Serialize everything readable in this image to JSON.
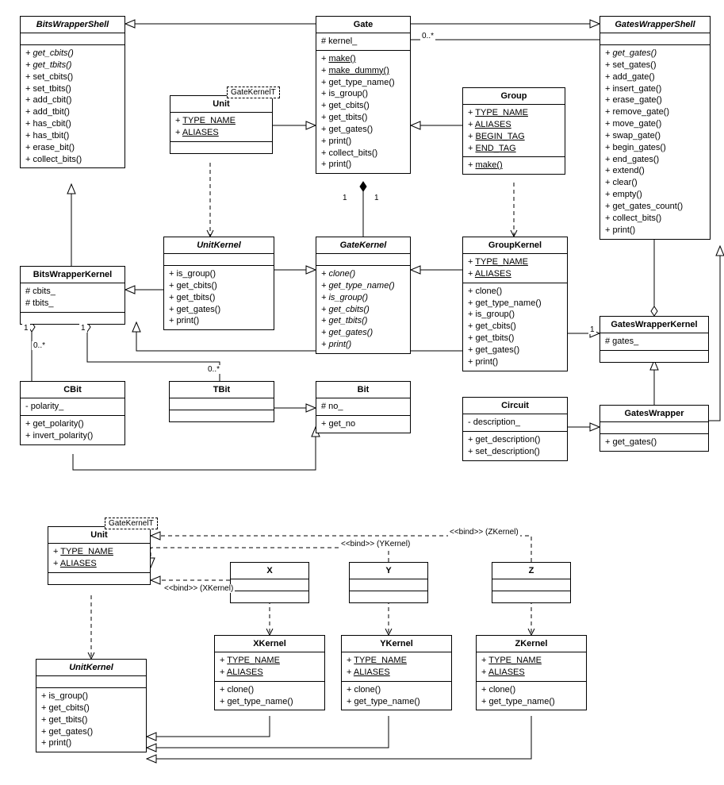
{
  "classes": {
    "BitsWrapperShell": {
      "name": "BitsWrapperShell",
      "italic": true,
      "sections": [
        {
          "items": [],
          "empty": true
        },
        {
          "items": [
            {
              "t": "+ get_cbits()",
              "i": true
            },
            {
              "t": "+ get_tbits()",
              "i": true
            },
            {
              "t": "+ set_cbits()"
            },
            {
              "t": "+ set_tbits()"
            },
            {
              "t": "+ add_cbit()"
            },
            {
              "t": "+ add_tbit()"
            },
            {
              "t": "+ has_cbit()"
            },
            {
              "t": "+ has_tbit()"
            },
            {
              "t": "+ erase_bit()"
            },
            {
              "t": "+ collect_bits()"
            }
          ]
        }
      ]
    },
    "Gate": {
      "name": "Gate",
      "sections": [
        {
          "items": [
            {
              "t": "# kernel_"
            }
          ]
        },
        {
          "items": [
            {
              "t": "+ ",
              "u": "make()"
            },
            {
              "t": "+ ",
              "u": "make_dummy()"
            },
            {
              "t": "+ get_type_name()"
            },
            {
              "t": "+ is_group()"
            },
            {
              "t": "+ get_cbits()"
            },
            {
              "t": "+ get_tbits()"
            },
            {
              "t": "+ get_gates()"
            },
            {
              "t": "+ print()"
            },
            {
              "t": "+ collect_bits()"
            },
            {
              "t": "+ print()"
            }
          ]
        }
      ]
    },
    "GatesWrapperShell": {
      "name": "GatesWrapperShell",
      "italic": true,
      "sections": [
        {
          "items": [],
          "empty": true
        },
        {
          "items": [
            {
              "t": "+ get_gates()",
              "i": true
            },
            {
              "t": "+ set_gates()"
            },
            {
              "t": "+ add_gate()"
            },
            {
              "t": "+ insert_gate()"
            },
            {
              "t": "+ erase_gate()"
            },
            {
              "t": "+ remove_gate()"
            },
            {
              "t": "+ move_gate()"
            },
            {
              "t": "+ swap_gate()"
            },
            {
              "t": "+ begin_gates()"
            },
            {
              "t": "+ end_gates()"
            },
            {
              "t": "+ extend()"
            },
            {
              "t": "+ clear()"
            },
            {
              "t": "+ empty()"
            },
            {
              "t": "+ get_gates_count()"
            },
            {
              "t": "+ collect_bits()"
            },
            {
              "t": "+ print()"
            }
          ]
        }
      ]
    },
    "Unit": {
      "name": "Unit",
      "template": "GateKernelT",
      "sections": [
        {
          "items": [
            {
              "t": "+ ",
              "u": "TYPE_NAME"
            },
            {
              "t": "+ ",
              "u": "ALIASES"
            }
          ]
        },
        {
          "items": [],
          "empty": true
        }
      ]
    },
    "Group": {
      "name": "Group",
      "sections": [
        {
          "items": [
            {
              "t": "+ ",
              "u": "TYPE_NAME"
            },
            {
              "t": "+ ",
              "u": "ALIASES"
            },
            {
              "t": "+ ",
              "u": "BEGIN_TAG"
            },
            {
              "t": "+ ",
              "u": "END_TAG"
            }
          ]
        },
        {
          "items": [
            {
              "t": "+ ",
              "u": "make()"
            }
          ]
        }
      ]
    },
    "UnitKernel": {
      "name": "UnitKernel",
      "italic": true,
      "sections": [
        {
          "items": [],
          "empty": true
        },
        {
          "items": [
            {
              "t": "+ is_group()"
            },
            {
              "t": "+ get_cbits()"
            },
            {
              "t": "+ get_tbits()"
            },
            {
              "t": "+ get_gates()"
            },
            {
              "t": "+ print()"
            }
          ]
        }
      ]
    },
    "GateKernel": {
      "name": "GateKernel",
      "italic": true,
      "sections": [
        {
          "items": [],
          "empty": true
        },
        {
          "items": [
            {
              "t": "+ clone()",
              "i": true
            },
            {
              "t": "+ get_type_name()",
              "i": true
            },
            {
              "t": "+ is_group()",
              "i": true
            },
            {
              "t": "+ get_cbits()",
              "i": true
            },
            {
              "t": "+ get_tbits()",
              "i": true
            },
            {
              "t": "+ get_gates()",
              "i": true
            },
            {
              "t": "+ print()",
              "i": true
            }
          ]
        }
      ]
    },
    "GroupKernel": {
      "name": "GroupKernel",
      "sections": [
        {
          "items": [
            {
              "t": "+ ",
              "u": "TYPE_NAME"
            },
            {
              "t": "+ ",
              "u": "ALIASES"
            }
          ]
        },
        {
          "items": [
            {
              "t": "+ clone()"
            },
            {
              "t": "+ get_type_name()"
            },
            {
              "t": "+ is_group()"
            },
            {
              "t": "+ get_cbits()"
            },
            {
              "t": "+ get_tbits()"
            },
            {
              "t": "+ get_gates()"
            },
            {
              "t": "+ print()"
            }
          ]
        }
      ]
    },
    "BitsWrapperKernel": {
      "name": "BitsWrapperKernel",
      "sections": [
        {
          "items": [
            {
              "t": "# cbits_"
            },
            {
              "t": "# tbits_"
            }
          ]
        },
        {
          "items": [],
          "empty": true
        }
      ]
    },
    "GatesWrapperKernel": {
      "name": "GatesWrapperKernel",
      "sections": [
        {
          "items": [
            {
              "t": "# gates_"
            }
          ]
        },
        {
          "items": [],
          "empty": true
        }
      ]
    },
    "CBit": {
      "name": "CBit",
      "sections": [
        {
          "items": [
            {
              "t": "- polarity_"
            }
          ]
        },
        {
          "items": [
            {
              "t": "+ get_polarity()"
            },
            {
              "t": "+ invert_polarity()"
            }
          ]
        }
      ]
    },
    "TBit": {
      "name": "TBit",
      "sections": [
        {
          "items": [],
          "empty": true
        },
        {
          "items": [],
          "empty": true
        }
      ]
    },
    "Bit": {
      "name": "Bit",
      "sections": [
        {
          "items": [
            {
              "t": "# no_"
            }
          ]
        },
        {
          "items": [
            {
              "t": "+ get_no"
            }
          ]
        }
      ]
    },
    "Circuit": {
      "name": "Circuit",
      "sections": [
        {
          "items": [
            {
              "t": "- description_"
            }
          ]
        },
        {
          "items": [
            {
              "t": "+ get_description()"
            },
            {
              "t": "+ set_description()"
            }
          ]
        }
      ]
    },
    "GatesWrapper": {
      "name": "GatesWrapper",
      "sections": [
        {
          "items": [],
          "empty": true
        },
        {
          "items": [
            {
              "t": "+ get_gates()"
            }
          ]
        }
      ]
    },
    "Unit2": {
      "name": "Unit",
      "template": "GateKernelT",
      "sections": [
        {
          "items": [
            {
              "t": "+ ",
              "u": "TYPE_NAME"
            },
            {
              "t": "+ ",
              "u": "ALIASES"
            }
          ]
        },
        {
          "items": [],
          "empty": true
        }
      ]
    },
    "X": {
      "name": "X",
      "sections": [
        {
          "items": [],
          "empty": true
        },
        {
          "items": [],
          "empty": true
        }
      ]
    },
    "Y": {
      "name": "Y",
      "sections": [
        {
          "items": [],
          "empty": true
        },
        {
          "items": [],
          "empty": true
        }
      ]
    },
    "Z": {
      "name": "Z",
      "sections": [
        {
          "items": [],
          "empty": true
        },
        {
          "items": [],
          "empty": true
        }
      ]
    },
    "XKernel": {
      "name": "XKernel",
      "sections": [
        {
          "items": [
            {
              "t": "+ ",
              "u": "TYPE_NAME"
            },
            {
              "t": "+ ",
              "u": "ALIASES"
            }
          ]
        },
        {
          "items": [
            {
              "t": "+ clone()"
            },
            {
              "t": "+ get_type_name()"
            }
          ]
        }
      ]
    },
    "YKernel": {
      "name": "YKernel",
      "sections": [
        {
          "items": [
            {
              "t": "+ ",
              "u": "TYPE_NAME"
            },
            {
              "t": "+ ",
              "u": "ALIASES"
            }
          ]
        },
        {
          "items": [
            {
              "t": "+ clone()"
            },
            {
              "t": "+ get_type_name()"
            }
          ]
        }
      ]
    },
    "ZKernel": {
      "name": "ZKernel",
      "sections": [
        {
          "items": [
            {
              "t": "+ ",
              "u": "TYPE_NAME"
            },
            {
              "t": "+ ",
              "u": "ALIASES"
            }
          ]
        },
        {
          "items": [
            {
              "t": "+ clone()"
            },
            {
              "t": "+ get_type_name()"
            }
          ]
        }
      ]
    },
    "UnitKernel2": {
      "name": "UnitKernel",
      "italic": true,
      "sections": [
        {
          "items": [],
          "empty": true
        },
        {
          "items": [
            {
              "t": "+ is_group()"
            },
            {
              "t": "+ get_cbits()"
            },
            {
              "t": "+ get_tbits()"
            },
            {
              "t": "+ get_gates()"
            },
            {
              "t": "+ print()"
            }
          ]
        }
      ]
    }
  },
  "labels": {
    "zero_star1": "0..*",
    "zero_star2": "0..*",
    "zero_star3": "0..*",
    "one_a": "1",
    "one_b": "1",
    "one_c": "1",
    "one_d": "1",
    "one_e": "1",
    "bind_x": "<<bind>> (XKernel)",
    "bind_y": "<<bind>> (YKernel)",
    "bind_z": "<<bind>> (ZKernel)"
  }
}
